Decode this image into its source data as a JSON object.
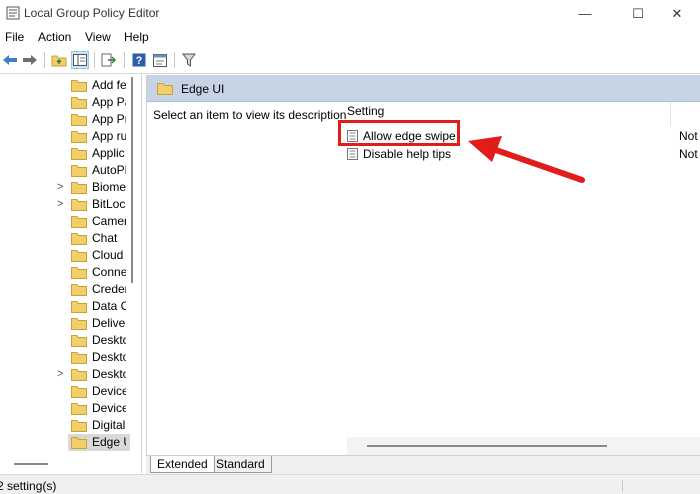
{
  "window": {
    "title": "Local Group Policy Editor",
    "controls": {
      "minimize": "—",
      "maximize": "☐",
      "close": "✕"
    }
  },
  "menu": [
    "File",
    "Action",
    "View",
    "Help"
  ],
  "toolbar": {
    "icons": [
      "back-arrow-icon",
      "forward-arrow-icon",
      "up-folder-icon",
      "show-hide-tree-icon",
      "export-list-icon",
      "help-icon",
      "properties-icon",
      "filter-icon"
    ]
  },
  "tree": {
    "items": [
      {
        "label": "Add fe",
        "expander": ""
      },
      {
        "label": "App Pa",
        "expander": ""
      },
      {
        "label": "App Pr",
        "expander": ""
      },
      {
        "label": "App ru",
        "expander": ""
      },
      {
        "label": "Applic",
        "expander": ""
      },
      {
        "label": "AutoPl",
        "expander": ""
      },
      {
        "label": "Biome",
        "expander": ">"
      },
      {
        "label": "BitLocl",
        "expander": ">"
      },
      {
        "label": "Camer",
        "expander": ""
      },
      {
        "label": "Chat",
        "expander": ""
      },
      {
        "label": "Cloud",
        "expander": ""
      },
      {
        "label": "Conne",
        "expander": ""
      },
      {
        "label": "Creder",
        "expander": ""
      },
      {
        "label": "Data C",
        "expander": ""
      },
      {
        "label": "Deliver",
        "expander": ""
      },
      {
        "label": "Deskto",
        "expander": ""
      },
      {
        "label": "Deskto",
        "expander": ""
      },
      {
        "label": "Deskto",
        "expander": ">"
      },
      {
        "label": "Device",
        "expander": ""
      },
      {
        "label": "Device",
        "expander": ""
      },
      {
        "label": "Digital",
        "expander": ""
      },
      {
        "label": "Edge U",
        "expander": "",
        "selected": true
      }
    ]
  },
  "right_pane": {
    "folder_title": "Edge UI",
    "description": "Select an item to view its description.",
    "column_setting": "Setting",
    "settings": [
      {
        "name": "Allow edge swipe",
        "state": "Not"
      },
      {
        "name": "Disable help tips",
        "state": "Not"
      }
    ]
  },
  "tabs": [
    "Extended",
    "Standard"
  ],
  "status": {
    "text": "2 setting(s)"
  },
  "colors": {
    "highlight": "#e21b1b",
    "header_bg": "#c6d4e6",
    "folder": "#f2cf6b"
  }
}
